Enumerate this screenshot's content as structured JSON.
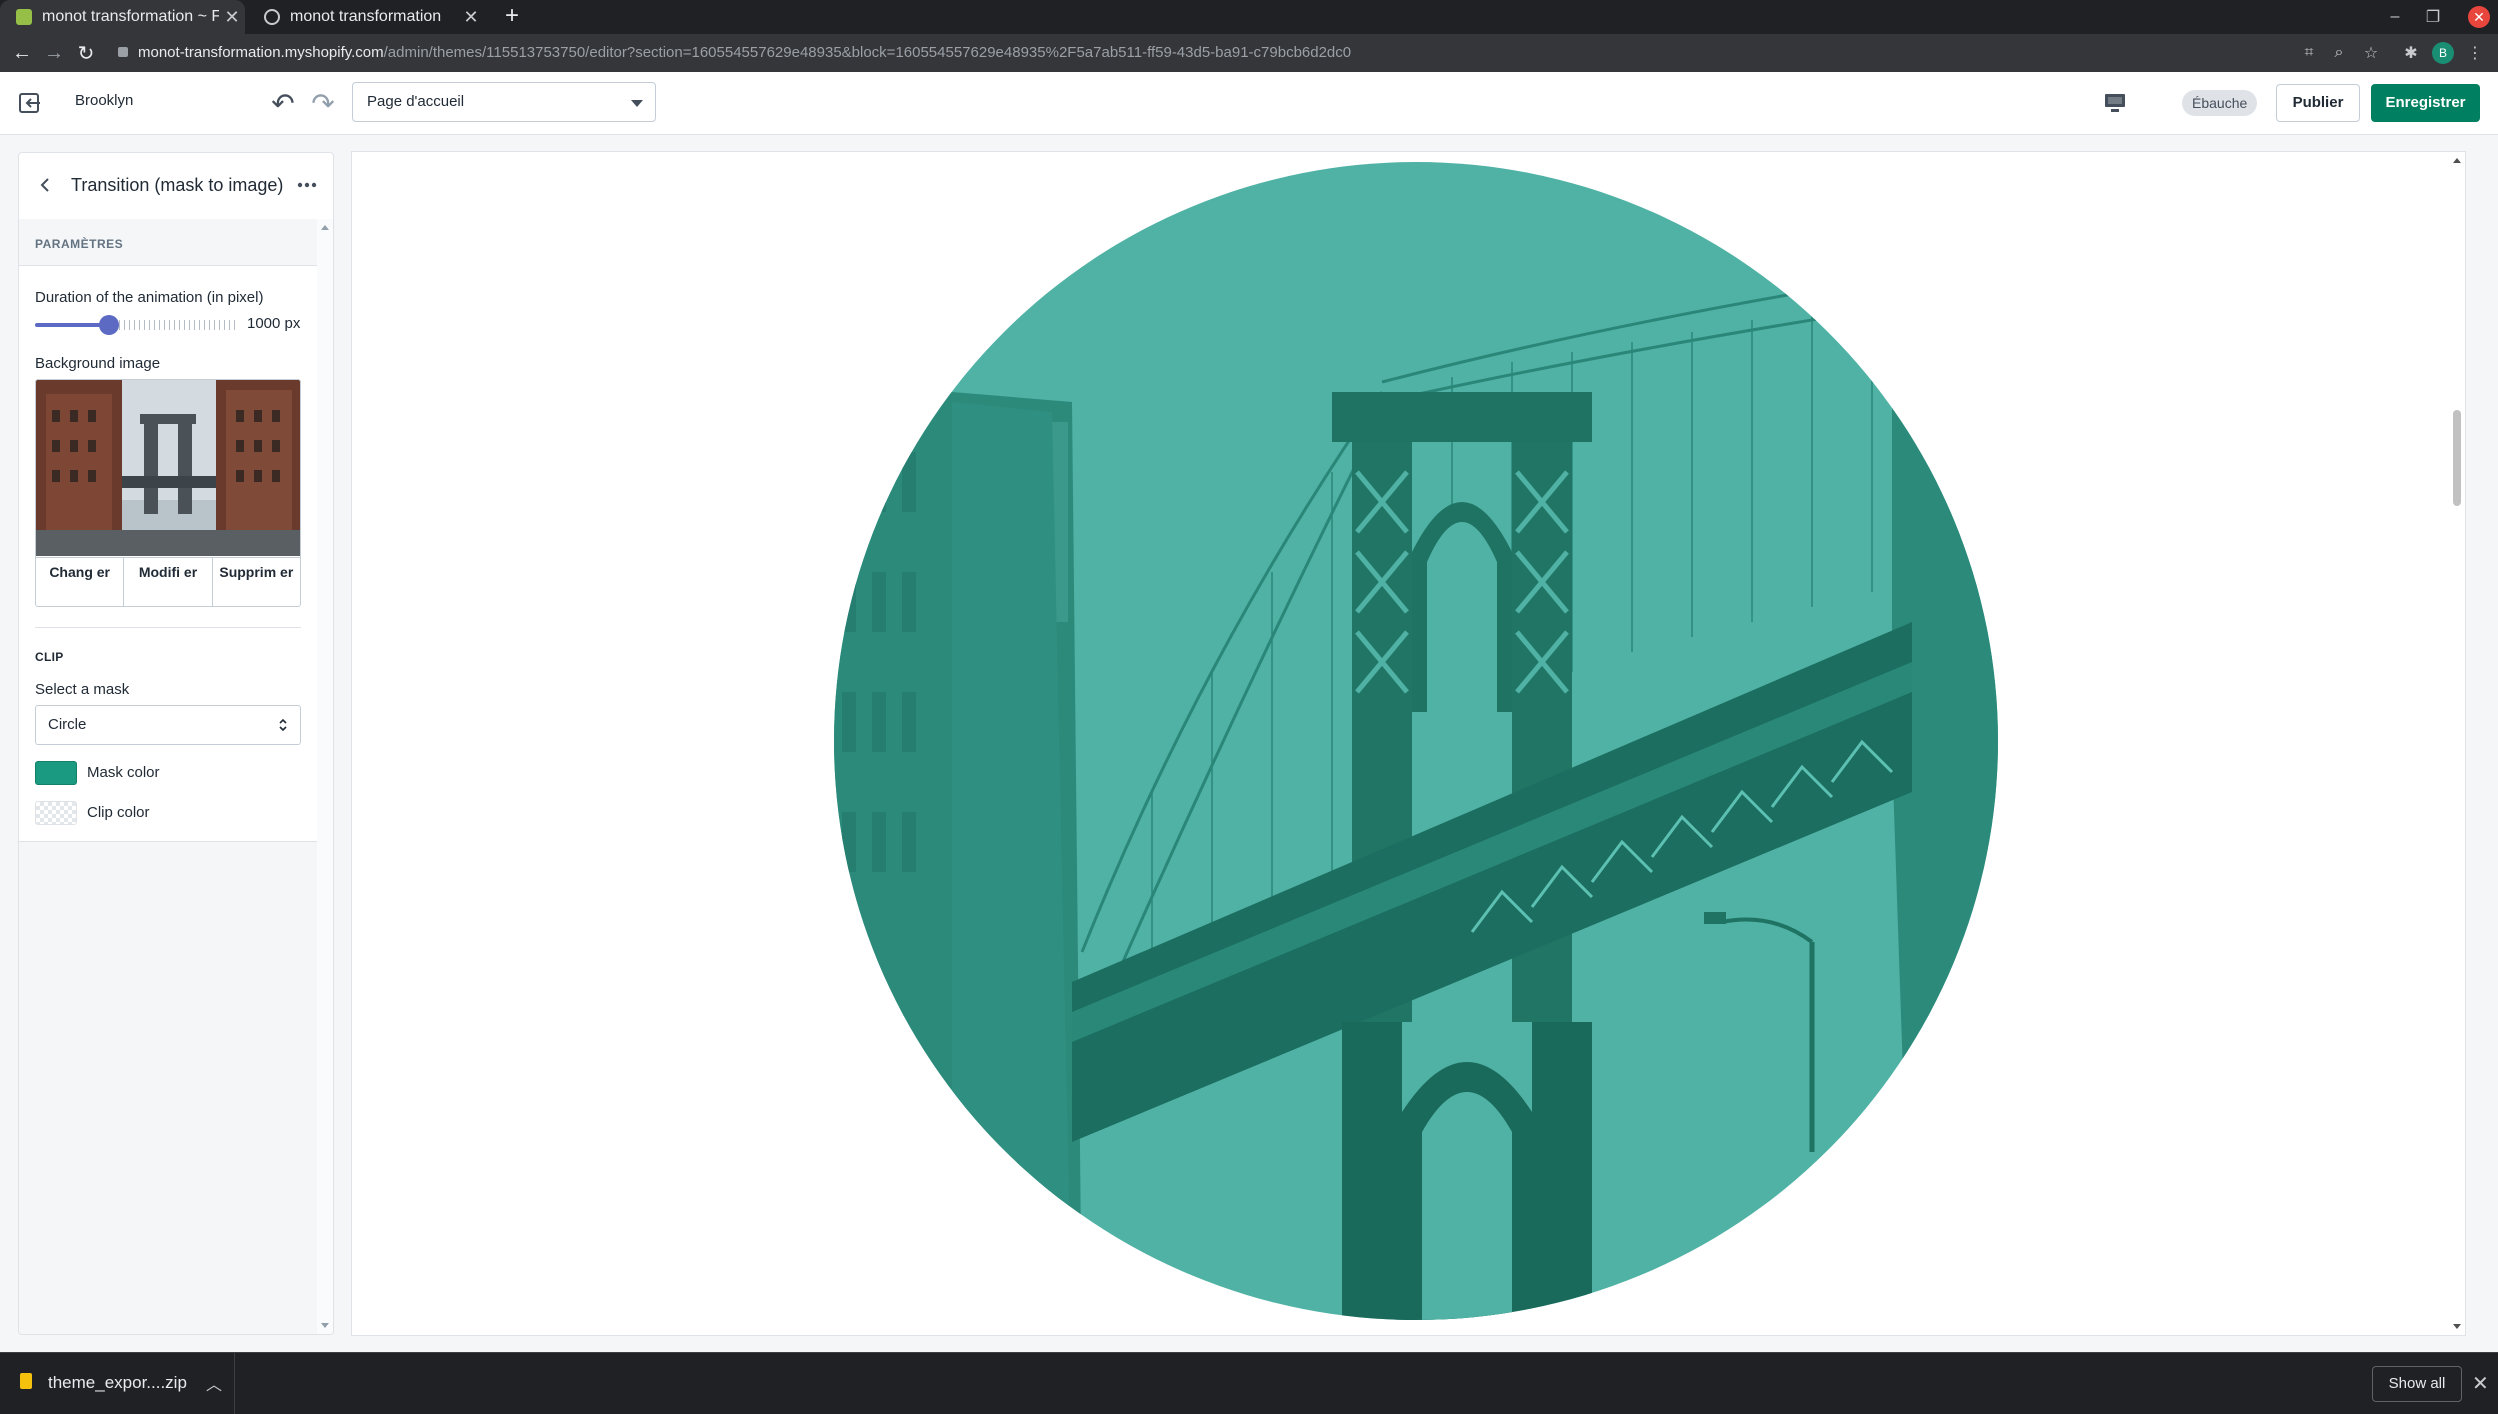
{
  "browser": {
    "tabs": [
      {
        "title": "monot transformation ~ F",
        "active": true
      },
      {
        "title": "monot transformation",
        "active": false
      }
    ],
    "new_tab": "+",
    "url_host": "monot-transformation.myshopify.com",
    "url_path": "/admin/themes/115513753750/editor?section=160554557629e48935&block=160554557629e48935%2F5a7ab511-ff59-43d5-ba91-c79bcb6d2dc0",
    "profile_initial": "B"
  },
  "editor": {
    "theme_name": "Brooklyn",
    "page_select": "Page d'accueil",
    "draft_badge": "Ébauche",
    "publish_label": "Publier",
    "save_label": "Enregistrer"
  },
  "sidebar": {
    "title": "Transition (mask to image)",
    "section_heading": "PARAMÈTRES",
    "duration_label": "Duration of the animation (in pixel)",
    "duration_value": "1000 px",
    "duration_fraction": 0.37,
    "bg_image_label": "Background image",
    "image_actions": {
      "change": "Chang er",
      "modify": "Modifi er",
      "remove": "Supprim er"
    },
    "clip_heading": "CLIP",
    "mask_label": "Select a mask",
    "mask_value": "Circle",
    "mask_color_label": "Mask color",
    "mask_color": "#1a9a80",
    "clip_color_label": "Clip color"
  },
  "preview": {
    "overlay_color": "#1e9c85"
  },
  "downloads": {
    "file_name": "theme_expor....zip",
    "show_all": "Show all"
  }
}
